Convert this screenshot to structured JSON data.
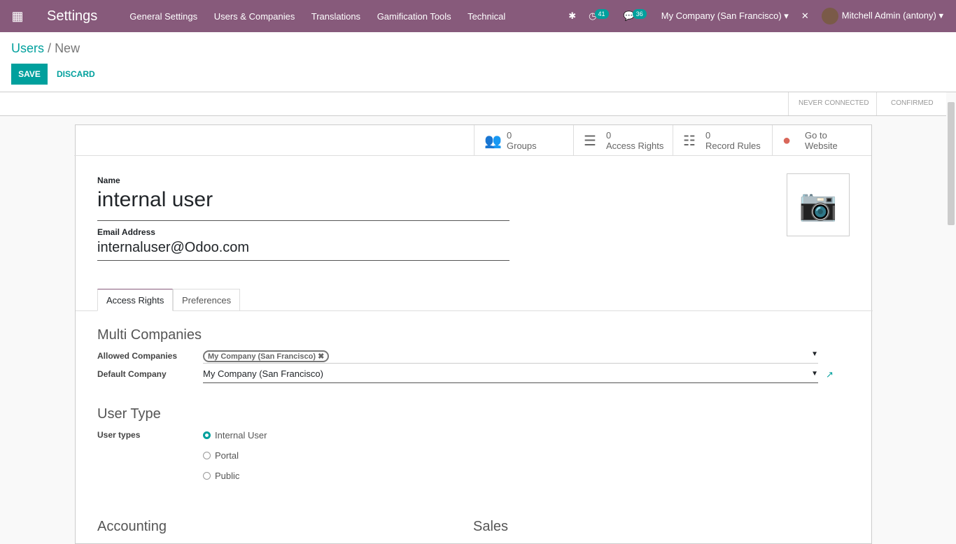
{
  "nav": {
    "app": "Settings",
    "menu": [
      "General Settings",
      "Users & Companies",
      "Translations",
      "Gamification Tools",
      "Technical"
    ],
    "activity_count": "41",
    "messages_count": "36",
    "company": "My Company (San Francisco)",
    "user": "Mitchell Admin (antony)"
  },
  "breadcrumb": {
    "parent": "Users",
    "current": "New"
  },
  "actions": {
    "save": "SAVE",
    "discard": "DISCARD"
  },
  "status": [
    "NEVER CONNECTED",
    "CONFIRMED"
  ],
  "smart_buttons": [
    {
      "icon": "users-icon",
      "value": "0",
      "label": "Groups"
    },
    {
      "icon": "list-icon",
      "value": "0",
      "label": "Access Rights"
    },
    {
      "icon": "list-ul-icon",
      "value": "0",
      "label": "Record Rules"
    },
    {
      "icon": "globe-icon",
      "value": "Go to",
      "label": "Website"
    }
  ],
  "form": {
    "name_label": "Name",
    "name": "internal user",
    "email_label": "Email Address",
    "email": "internaluser@Odoo.com"
  },
  "tabs": [
    "Access Rights",
    "Preferences"
  ],
  "multi": {
    "title": "Multi Companies",
    "allowed_label": "Allowed Companies",
    "allowed_tag": "My Company (San Francisco)",
    "default_label": "Default Company",
    "default_value": "My Company (San Francisco)"
  },
  "user_type": {
    "title": "User Type",
    "label": "User types",
    "options": [
      "Internal User",
      "Portal",
      "Public"
    ],
    "selected": "Internal User"
  },
  "sections": {
    "accounting": "Accounting",
    "sales": "Sales"
  }
}
